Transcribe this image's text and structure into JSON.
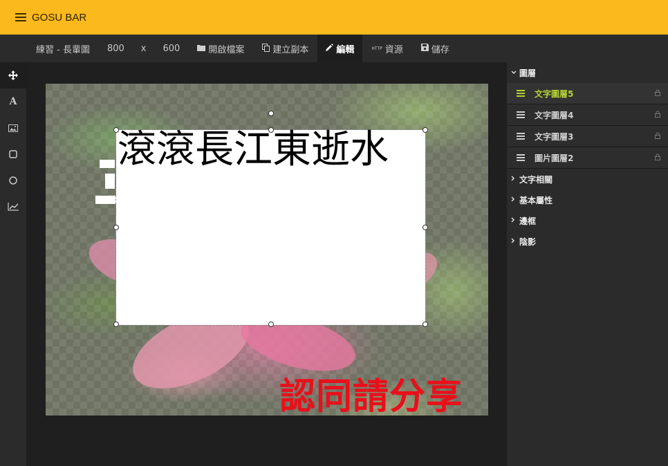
{
  "app": {
    "title": "GOSU BAR"
  },
  "toolbar": {
    "doc_name": "練習 - 長輩圖",
    "width": "800",
    "times": "x",
    "height": "600",
    "open_label": "開啟檔案",
    "copy_label": "建立副本",
    "edit_label": "編輯",
    "resource_label": "資源",
    "resource_prefix": "HTTP",
    "save_label": "儲存"
  },
  "tools": [
    "move-tool",
    "text-tool",
    "image-tool",
    "rectangle-tool",
    "circle-tool",
    "chart-tool"
  ],
  "canvas": {
    "main_text": "滾滾長江東逝水",
    "share_text": "認同請分享"
  },
  "panel": {
    "layers_title": "圖層",
    "layers": [
      {
        "label": "文字圖層5",
        "active": true
      },
      {
        "label": "文字圖層4",
        "active": false
      },
      {
        "label": "文字圖層3",
        "active": false
      },
      {
        "label": "圖片圖層2",
        "active": false
      }
    ],
    "sections": [
      "文字相關",
      "基本屬性",
      "邊框",
      "陰影"
    ]
  },
  "colors": {
    "brand": "#fbb91e",
    "accent": "#b5d334",
    "share_red": "#e8101a"
  }
}
